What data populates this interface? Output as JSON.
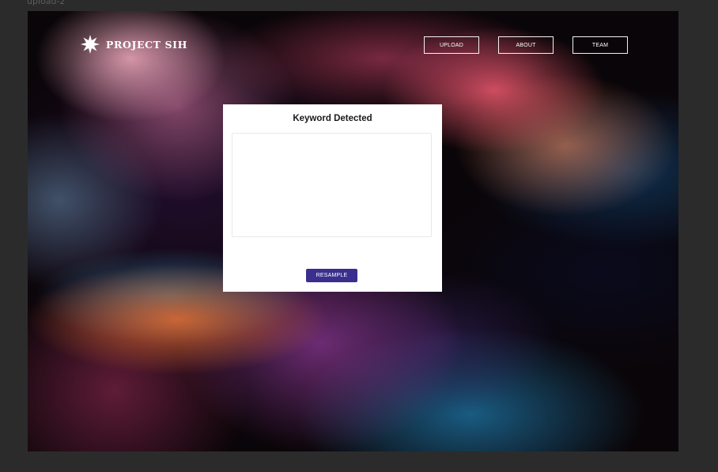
{
  "frame": {
    "label": "upload-2"
  },
  "header": {
    "logo_text": "PROJECT SIH",
    "logo_icon": "starburst-icon",
    "nav": [
      {
        "label": "UPLOAD"
      },
      {
        "label": "ABOUT"
      },
      {
        "label": "TEAM"
      }
    ]
  },
  "card": {
    "title": "Keyword Detected",
    "result_value": "",
    "button_label": "RESAMPLE",
    "button_color": "#3a2f8e"
  }
}
